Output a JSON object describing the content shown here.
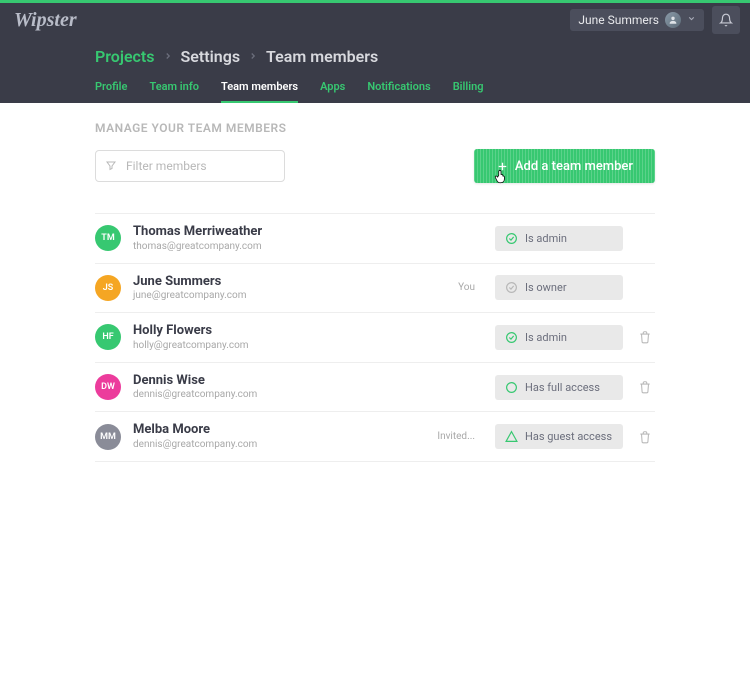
{
  "header": {
    "logo": "Wipster",
    "user_name": "June Summers"
  },
  "breadcrumb": {
    "root": "Projects",
    "section": "Settings",
    "page": "Team members"
  },
  "tabs": {
    "profile": "Profile",
    "team_info": "Team info",
    "team_members": "Team members",
    "apps": "Apps",
    "notifications": "Notifications",
    "billing": "Billing"
  },
  "section": {
    "title": "MANAGE YOUR TEAM MEMBERS",
    "filter_placeholder": "Filter members",
    "add_button": "Add a team member"
  },
  "meta": {
    "you": "You",
    "invited": "Invited..."
  },
  "roles": {
    "admin": "Is admin",
    "owner": "Is owner",
    "full": "Has full access",
    "guest": "Has guest access"
  },
  "members": [
    {
      "initials": "TM",
      "name": "Thomas Merriweather",
      "email": "thomas@greatcompany.com",
      "avatar_color": "#37c871",
      "role": "admin",
      "role_icon_color": "#37c871",
      "meta": "",
      "deletable": false
    },
    {
      "initials": "JS",
      "name": "June Summers",
      "email": "june@greatcompany.com",
      "avatar_color": "#f5a623",
      "role": "owner",
      "role_icon_color": "#b8b8b8",
      "meta": "you",
      "deletable": false
    },
    {
      "initials": "HF",
      "name": "Holly Flowers",
      "email": "holly@greatcompany.com",
      "avatar_color": "#37c871",
      "role": "admin",
      "role_icon_color": "#37c871",
      "meta": "",
      "deletable": true
    },
    {
      "initials": "DW",
      "name": "Dennis Wise",
      "email": "dennis@greatcompany.com",
      "avatar_color": "#ec3c9c",
      "role": "full",
      "role_icon_color": "#37c871",
      "meta": "",
      "deletable": true
    },
    {
      "initials": "MM",
      "name": "Melba Moore",
      "email": "dennis@greatcompany.com",
      "avatar_color": "#8a8c98",
      "role": "guest",
      "role_icon_color": "#37c871",
      "meta": "invited",
      "deletable": true
    }
  ]
}
